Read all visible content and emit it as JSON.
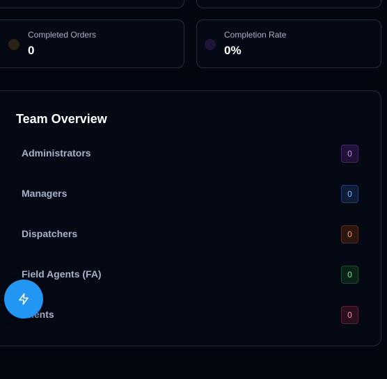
{
  "stats": [
    {
      "label": "Completed Orders",
      "value": "0",
      "dot_color": "#2a2216"
    },
    {
      "label": "Completion Rate",
      "value": "0%",
      "dot_color": "#1f1438"
    }
  ],
  "team": {
    "title": "Team Overview",
    "rows": [
      {
        "label": "Administrators",
        "count": "0",
        "text_color": "#c08ff0",
        "bg": "#1f1236",
        "border": "#3d2566"
      },
      {
        "label": "Managers",
        "count": "0",
        "text_color": "#8fb3f0",
        "bg": "#0f1c36",
        "border": "#223c6b"
      },
      {
        "label": "Dispatchers",
        "count": "0",
        "text_color": "#f0a070",
        "bg": "#2a1510",
        "border": "#5a2e1c"
      },
      {
        "label": "Field Agents (FA)",
        "count": "0",
        "text_color": "#7ee0a0",
        "bg": "#0b2216",
        "border": "#1d4a2c"
      },
      {
        "label": "Clients",
        "count": "0",
        "text_color": "#f090b0",
        "bg": "#2a0f1c",
        "border": "#5a2038"
      }
    ]
  },
  "fab": {
    "icon": "lightning-icon"
  }
}
